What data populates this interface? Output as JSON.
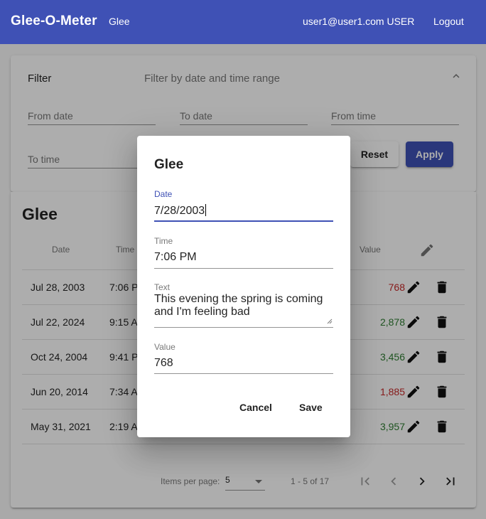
{
  "toolbar": {
    "app_title": "Glee-O-Meter",
    "nav": "Glee",
    "user": "user1@user1.com USER",
    "logout": "Logout"
  },
  "filter": {
    "title": "Filter",
    "description": "Filter by date and time range",
    "from_date": "From date",
    "to_date": "To date",
    "from_time": "From time",
    "to_time": "To time",
    "reset": "Reset",
    "apply": "Apply"
  },
  "table": {
    "title": "Glee",
    "columns": {
      "date": "Date",
      "time": "Time",
      "value": "Value"
    },
    "rows": [
      {
        "date": "Jul 28, 2003",
        "time": "7:06 P",
        "value": "768",
        "color": "#c62828"
      },
      {
        "date": "Jul 22, 2024",
        "time": "9:15 A",
        "value": "2,878",
        "color": "#2e7d32"
      },
      {
        "date": "Oct 24, 2004",
        "time": "9:41 P",
        "value": "3,456",
        "color": "#2e7d32"
      },
      {
        "date": "Jun 20, 2014",
        "time": "7:34 A",
        "value": "1,885",
        "color": "#c62828"
      },
      {
        "date": "May 31, 2021",
        "time": "2:19 A",
        "value": "3,957",
        "color": "#2e7d32"
      }
    ],
    "paginator": {
      "label": "Items per page:",
      "page_size": "5",
      "range": "1 - 5 of 17"
    }
  },
  "dialog": {
    "title": "Glee",
    "date_label": "Date",
    "date_value": "7/28/2003",
    "time_label": "Time",
    "time_value": "7:06 PM",
    "text_label": "Text",
    "text_value": "This evening the spring is coming and I'm feeling bad",
    "value_label": "Value",
    "value_value": "768",
    "cancel": "Cancel",
    "save": "Save"
  }
}
